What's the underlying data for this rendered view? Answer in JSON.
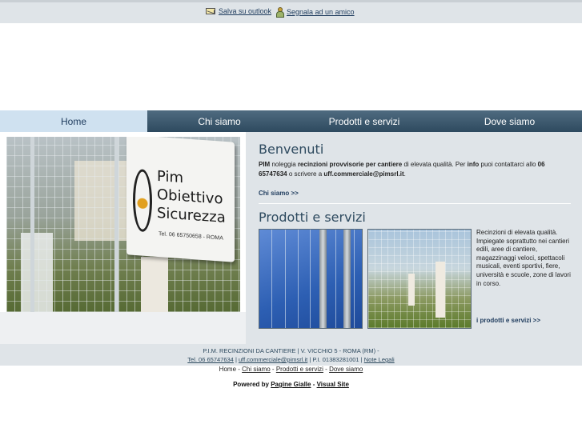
{
  "topbar": {
    "outlook_label": "Salva su outlook",
    "amico_label": "Segnala ad un amico"
  },
  "nav": {
    "items": [
      "Home",
      "Chi siamo",
      "Prodotti e servizi",
      "Dove siamo"
    ],
    "active": "Home"
  },
  "hero": {
    "sign_line1": "Pim",
    "sign_line2": "Obiettivo",
    "sign_line3": "Sicurezza",
    "sign_phone": "Tel. 06 65750658 - ROMA"
  },
  "welcome": {
    "title": "Benvenuti",
    "t1": "PIM",
    "t2": " noleggia ",
    "t3": "recinzioni provvisorie per cantiere",
    "t4": " di elevata qualità. Per ",
    "t5": "info",
    "t6": " puoi contattarci allo ",
    "t7": "06 65747634",
    "t8": " o scrivere a ",
    "t9": "uff.commerciale@pimsrl.it",
    "t10": ".",
    "link": "Chi siamo >>"
  },
  "products": {
    "title": "Prodotti e servizi",
    "description": "Recinzioni di elevata qualità. Impiegate soprattutto nei cantieri edili, aree di cantiere, magazzinaggi veloci, spettacoli musicali, eventi sportivi, fiere, università e scuole, zone di lavori in corso.",
    "link": "i prodotti e servizi >>"
  },
  "footer": {
    "line1": "P.I.M. RECINZIONI DA CANTIERE | V. VICCHIO 5 - ROMA (RM) -",
    "tel": "Tel. 06 65747634",
    "sep1": " | ",
    "email": "uff.commerciale@pimsrl.it",
    "piva": " | P.I. 01383281001 | ",
    "legal": "Note Legali"
  },
  "bottomnav": {
    "home": "Home",
    "sep": " - ",
    "chi": "Chi siamo",
    "prod": "Prodotti e servizi",
    "dove": "Dove siamo"
  },
  "powered": {
    "label": "Powered by ",
    "pg": "Pagine Gialle",
    "sep": " - ",
    "vs": "Visual Site"
  },
  "colors": {
    "nav_bg": "#2e4a5f",
    "nav_active": "#cfe1f0",
    "panel_bg": "#dfe4e8",
    "title": "#2e4a5f"
  }
}
